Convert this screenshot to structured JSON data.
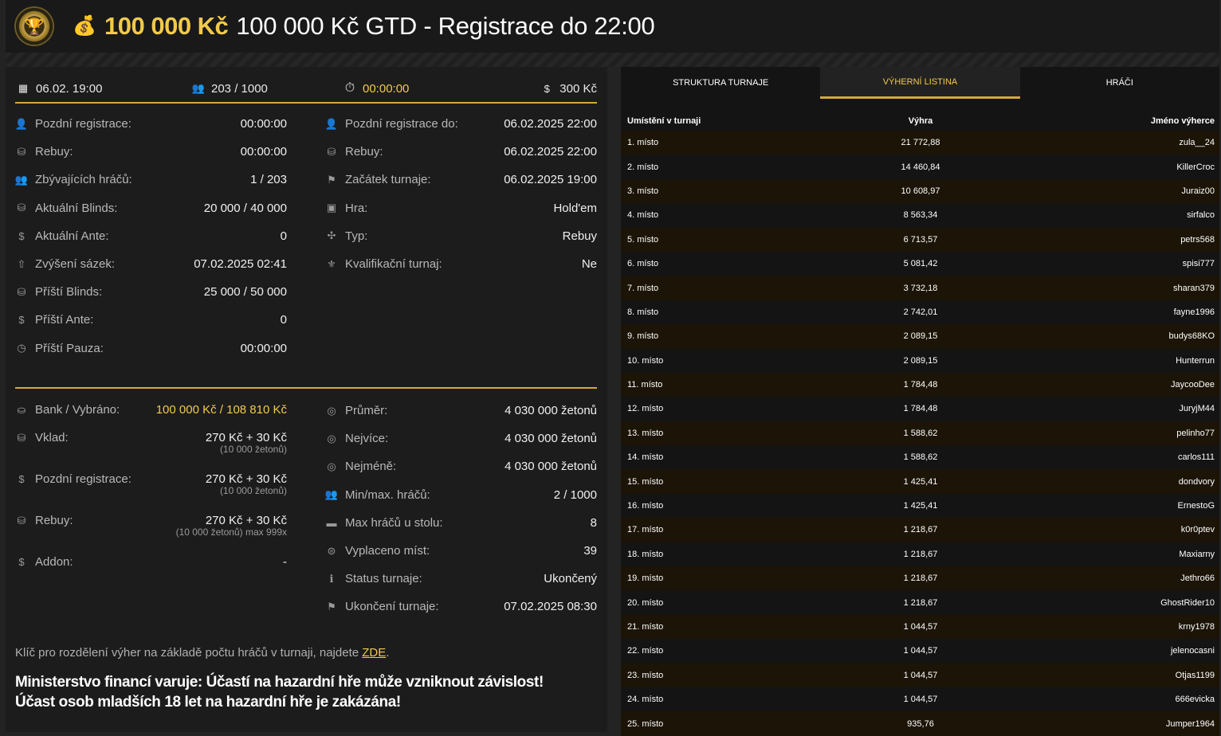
{
  "header": {
    "title_gold": "100 000 Kč",
    "title_white": "100 000 Kč GTD - Registrace do 22:00"
  },
  "topbar": {
    "date": "06.02. 19:00",
    "players": "203 / 1000",
    "timer": "00:00:00",
    "buyin": "300 Kč"
  },
  "info_left": [
    {
      "label": "Pozdní registrace:",
      "value": "00:00:00",
      "icon": "user-icon"
    },
    {
      "label": "Rebuy:",
      "value": "00:00:00",
      "icon": "coins-icon"
    },
    {
      "label": "Zbývajících hráčů:",
      "value": "1 / 203",
      "icon": "users-icon"
    },
    {
      "label": "Aktuální Blinds:",
      "value": "20 000 / 40 000",
      "icon": "coins-icon"
    },
    {
      "label": "Aktuální Ante:",
      "value": "0",
      "icon": "dollar-icon"
    },
    {
      "label": "Zvýšení sázek:",
      "value": "07.02.2025 02:41",
      "icon": "arrow-up-icon"
    },
    {
      "label": "Příští Blinds:",
      "value": "25 000 / 50 000",
      "icon": "coins-icon"
    },
    {
      "label": "Příští Ante:",
      "value": "0",
      "icon": "dollar-icon"
    },
    {
      "label": "Příští Pauza:",
      "value": "00:00:00",
      "icon": "clock-icon"
    }
  ],
  "info_right": [
    {
      "label": "Pozdní registrace do:",
      "value": "06.02.2025 22:00",
      "icon": "user-icon"
    },
    {
      "label": "Rebuy:",
      "value": "06.02.2025 22:00",
      "icon": "coins-icon"
    },
    {
      "label": "Začátek turnaje:",
      "value": "06.02.2025 19:00",
      "icon": "flag-icon"
    },
    {
      "label": "Hra:",
      "value": "Hold'em",
      "icon": "cards-icon"
    },
    {
      "label": "Typ:",
      "value": "Rebuy",
      "icon": "grid-icon"
    },
    {
      "label": "Kvalifikační turnaj:",
      "value": "Ne",
      "icon": "medal-icon"
    }
  ],
  "bank_left": [
    {
      "label": "Bank / Vybráno:",
      "value": "100 000 Kč / 108 810 Kč",
      "sub": "",
      "icon": "bag-icon"
    },
    {
      "label": "Vklad:",
      "value": "270 Kč + 30 Kč",
      "sub": "(10 000 žetonů)",
      "icon": "coins-icon"
    },
    {
      "label": "Pozdní registrace:",
      "value": "270 Kč + 30 Kč",
      "sub": "(10 000 žetonů)",
      "icon": "dollar-icon"
    },
    {
      "label": "Rebuy:",
      "value": "270 Kč + 30 Kč",
      "sub": "(10 000 žetonů) max 999x",
      "icon": "coins-icon"
    },
    {
      "label": "Addon:",
      "value": "-",
      "sub": "",
      "icon": "dollar-icon"
    }
  ],
  "bank_right": [
    {
      "label": "Průměr:",
      "value": "4 030 000 žetonů",
      "icon": "chip-icon"
    },
    {
      "label": "Nejvíce:",
      "value": "4 030 000 žetonů",
      "icon": "chip-icon"
    },
    {
      "label": "Nejméně:",
      "value": "4 030 000 žetonů",
      "icon": "chip-icon"
    },
    {
      "label": "Min/max. hráčů:",
      "value": "2 / 1000",
      "icon": "users-icon"
    },
    {
      "label": "Max hráčů u stolu:",
      "value": "8",
      "icon": "table-icon"
    },
    {
      "label": "Vyplaceno míst:",
      "value": "39",
      "icon": "payout-icon"
    },
    {
      "label": "Status turnaje:",
      "value": "Ukončený",
      "icon": "info-icon"
    },
    {
      "label": "Ukončení turnaje:",
      "value": "07.02.2025 08:30",
      "icon": "flag-icon"
    }
  ],
  "note": {
    "text": "Klíč pro rozdělení výher na základě počtu hráčů v turnaji, najdete ",
    "link": "ZDE",
    "end": "."
  },
  "warning": {
    "line1": "Ministerstvo financí varuje: Účastí na hazardní hře může vzniknout závislost!",
    "line2": "Účast osob mladších 18 let na hazardní hře je zakázána!"
  },
  "tabs": [
    "STRUKTURA TURNAJE",
    "VÝHERNÍ LISTINA",
    "HRÁČI"
  ],
  "table": {
    "headers": [
      "Umístění v turnaji",
      "Výhra",
      "Jméno výherce"
    ],
    "rows": [
      [
        "1. místo",
        "21 772,88",
        "zula__24"
      ],
      [
        "2. místo",
        "14 460,84",
        "KillerCroc"
      ],
      [
        "3. místo",
        "10 608,97",
        "Juraiz00"
      ],
      [
        "4. místo",
        "8 563,34",
        "sirfalco"
      ],
      [
        "5. místo",
        "6 713,57",
        "petrs568"
      ],
      [
        "6. místo",
        "5 081,42",
        "spisi777"
      ],
      [
        "7. místo",
        "3 732,18",
        "sharan379"
      ],
      [
        "8. místo",
        "2 742,01",
        "fayne1996"
      ],
      [
        "9. místo",
        "2 089,15",
        "budys68KO"
      ],
      [
        "10. místo",
        "2 089,15",
        "Hunterrun"
      ],
      [
        "11. místo",
        "1 784,48",
        "JaycooDee"
      ],
      [
        "12. místo",
        "1 784,48",
        "JuryjM44"
      ],
      [
        "13. místo",
        "1 588,62",
        "pelinho77"
      ],
      [
        "14. místo",
        "1 588,62",
        "carlos111"
      ],
      [
        "15. místo",
        "1 425,41",
        "dondvory"
      ],
      [
        "16. místo",
        "1 425,41",
        "ErnestoG"
      ],
      [
        "17. místo",
        "1 218,67",
        "k0r0ptev"
      ],
      [
        "18. místo",
        "1 218,67",
        "Maxiarny"
      ],
      [
        "19. místo",
        "1 218,67",
        "Jethro66"
      ],
      [
        "20. místo",
        "1 218,67",
        "GhostRider10"
      ],
      [
        "21. místo",
        "1 044,57",
        "krny1978"
      ],
      [
        "22. místo",
        "1 044,57",
        "jelenocasni"
      ],
      [
        "23. místo",
        "1 044,57",
        "Otjas1199"
      ],
      [
        "24. místo",
        "1 044,57",
        "666evicka"
      ],
      [
        "25. místo",
        "935,76",
        "Jumper1964"
      ]
    ]
  }
}
